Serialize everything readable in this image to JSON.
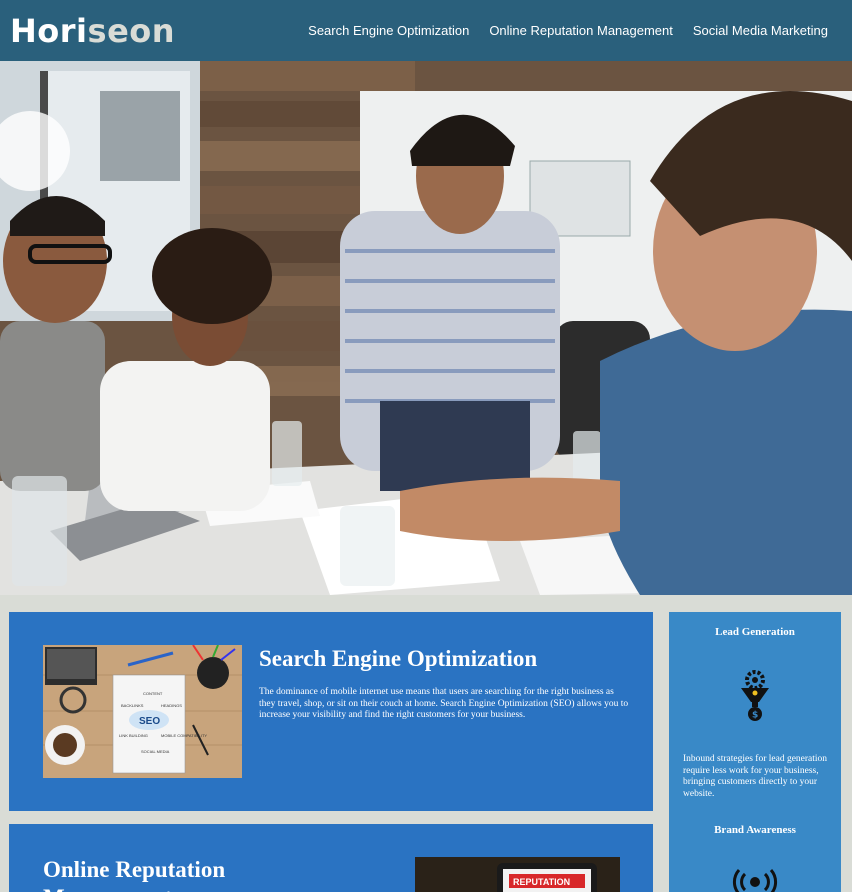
{
  "header": {
    "logo_main": "Hori",
    "logo_accent": "seon",
    "nav": [
      {
        "label": "Search Engine Optimization"
      },
      {
        "label": "Online Reputation Management"
      },
      {
        "label": "Social Media Marketing"
      }
    ]
  },
  "hero": {
    "image": "team-meeting-photo"
  },
  "main": {
    "seo": {
      "title": "Search Engine Optimization",
      "text": "The dominance of mobile internet use means that users are searching for the right business as they travel, shop, or sit on their couch at home. Search Engine Optimization (SEO) allows you to increase your visibility and find the right customers for your business.",
      "image_words": [
        "CONTENT",
        "BACKLINKS",
        "HEADINGS",
        "SEO",
        "LINK BUILDING",
        "MOBILE COMPATIBILITY",
        "SOCIAL MEDIA"
      ]
    },
    "orm": {
      "title": "Online Reputation Management",
      "image_word": "REPUTATION"
    }
  },
  "sidebar": {
    "lead": {
      "title": "Lead Generation",
      "text": "Inbound strategies for lead generation require less work for your business, bringing customers directly to your website.",
      "icon": "funnel-gear-icon"
    },
    "brand": {
      "title": "Brand Awareness",
      "icon": "broadcast-icon"
    }
  },
  "colors": {
    "header_bg": "#2a607c",
    "page_bg": "#d9dcd6",
    "card_bg": "#2a73c2",
    "sidebar_bg": "#3989c7"
  }
}
